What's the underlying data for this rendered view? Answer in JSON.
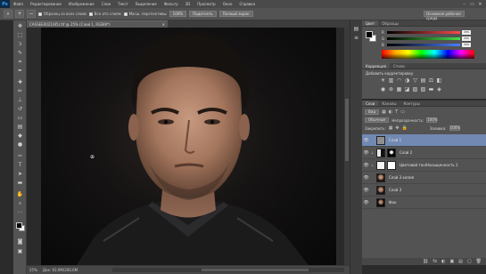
{
  "menubar": {
    "logo": "Ps",
    "items": [
      "Файл",
      "Редактирование",
      "Изображение",
      "Слои",
      "Текст",
      "Выделение",
      "Фильтр",
      "3D",
      "Просмотр",
      "Окно",
      "Справка"
    ],
    "controls": [
      "–",
      "▭",
      "✕"
    ]
  },
  "options": {
    "sample_all": "Образец со всех слоев",
    "all_layers": "Все ато слоям",
    "auto_enhance": "Масш. перспективы",
    "size": "100%",
    "zoom_fit": "Подогнать",
    "fill_screen": "Полный экран",
    "workspace": "Основная рабочая среда"
  },
  "document": {
    "tab_title": "CASSEE0021(85).tif @ 25% (Слой 1, RGB/8*)",
    "tab_close": "✕"
  },
  "status": {
    "zoom": "25%",
    "doc_size": "Док: 63,9M/200,6M"
  },
  "color_panel": {
    "tabs": [
      "Цвет",
      "Образцы"
    ],
    "sliders": [
      {
        "letter": "R",
        "value": "255",
        "color": "#ff4a4a"
      },
      {
        "letter": "G",
        "value": "255",
        "color": "#46e046"
      },
      {
        "letter": "B",
        "value": "255",
        "color": "#4b7dff"
      }
    ],
    "fg_color": "#000000",
    "bg_color": "#ffffff"
  },
  "adjustments": {
    "tabs": [
      "Коррекция",
      "Стили"
    ],
    "title": "Добавить корректировку",
    "icons": [
      "brightness-icon",
      "levels-icon",
      "curves-icon",
      "exposure-icon",
      "vibrance-icon",
      "hue-icon",
      "balance-icon",
      "bw-icon",
      "photo-filter-icon",
      "channel-mixer-icon",
      "color-lookup-icon",
      "invert-icon",
      "posterize-icon",
      "threshold-icon",
      "gradient-map-icon",
      "selective-color-icon"
    ],
    "glyphs": [
      "☀",
      "▥",
      "◠",
      "◑",
      "▽",
      "▤",
      "⚖",
      "◧",
      "◉",
      "⊛",
      "▦",
      "◪",
      "▨",
      "▧",
      "▬",
      "◈"
    ]
  },
  "layers_panel": {
    "tabs": [
      "Слои",
      "Каналы",
      "Контуры"
    ],
    "kind": "Вид",
    "blend": "Обычные",
    "opacity_label": "Непрозрачность:",
    "opacity": "100%",
    "lock_label": "Закрепить:",
    "fill_label": "Заливка:",
    "fill": "100%",
    "layers": [
      {
        "name": "Слой 1",
        "thumb": "gray",
        "mask": "",
        "selected": true,
        "link": false
      },
      {
        "name": "Слой 2",
        "thumb": "half",
        "mask": "dark",
        "selected": false,
        "link": true
      },
      {
        "name": "Цветовой тон/Насыщенность 1",
        "thumb": "white",
        "mask": "white",
        "selected": false,
        "link": true
      },
      {
        "name": "Слой 3 копия",
        "thumb": "face",
        "mask": "",
        "selected": false,
        "link": false
      },
      {
        "name": "Слой 3",
        "thumb": "face",
        "mask": "",
        "selected": false,
        "link": false
      },
      {
        "name": "Фон",
        "thumb": "photo-t",
        "mask": "",
        "selected": false,
        "link": false
      }
    ],
    "footer": [
      "⛓",
      "fx",
      "◐",
      "▣",
      "▤",
      "▢",
      "🗑"
    ]
  }
}
